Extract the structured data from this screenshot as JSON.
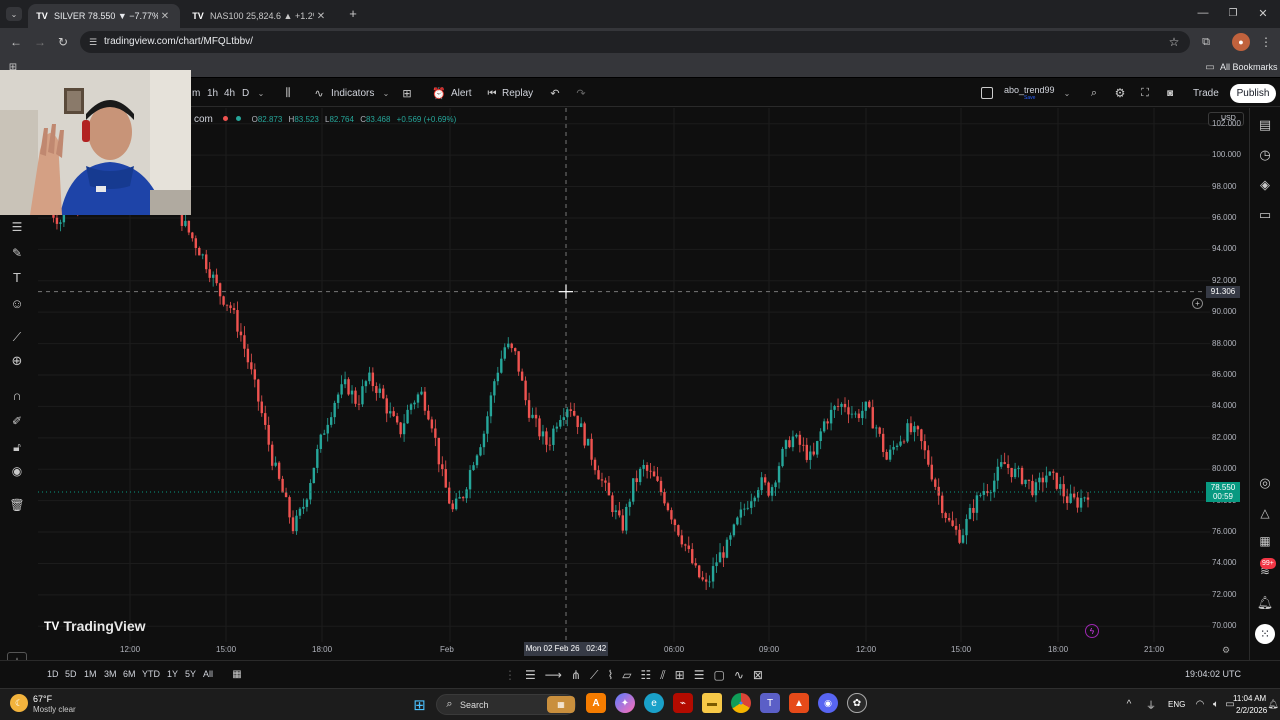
{
  "browser": {
    "tabs": [
      {
        "favicon": "tradingview-icon",
        "title": "SILVER 78.550 ▼ −7.77% abo_t...",
        "active": true
      },
      {
        "favicon": "tradingview-icon",
        "title": "NAS100 25,824.6 ▲ +1.2% abo...",
        "active": false
      }
    ],
    "url": "tradingview.com/chart/MFQLtbbv/",
    "all_bookmarks": "All Bookmarks"
  },
  "toolbar": {
    "intervals": [
      "m",
      "1h",
      "4h",
      "D"
    ],
    "indicators": "Indicators",
    "alert": "Alert",
    "replay": "Replay",
    "layout_name": "abo_trend99",
    "layout_status": "Save",
    "trade": "Trade",
    "publish": "Publish"
  },
  "legend": {
    "symbol": "com",
    "o_label": "O",
    "o": "82.873",
    "h_label": "H",
    "h": "83.523",
    "l_label": "L",
    "l": "82.764",
    "c_label": "C",
    "c": "83.468",
    "change": "+0.569 (+0.69%)"
  },
  "price_axis": {
    "currency": "USD",
    "ticks": [
      "102.000",
      "100.000",
      "98.000",
      "96.000",
      "94.000",
      "92.000",
      "90.000",
      "88.000",
      "86.000",
      "84.000",
      "82.000",
      "80.000",
      "78.000",
      "76.000",
      "74.000",
      "72.000",
      "70.000"
    ],
    "crosshair_price": "91.306",
    "last_price": "78.550",
    "countdown": "00:59"
  },
  "time_axis": {
    "ticks": [
      "12:00",
      "15:00",
      "18:00",
      "Feb",
      "06:00",
      "09:00",
      "12:00",
      "15:00",
      "18:00",
      "21:00"
    ],
    "crosshair_time": "Mon 02 Feb 26   02:42"
  },
  "watermark": "TradingView",
  "bottom": {
    "ranges": [
      "1D",
      "5D",
      "1M",
      "3M",
      "6M",
      "YTD",
      "1Y",
      "5Y",
      "All"
    ],
    "clock": "19:04:02 UTC"
  },
  "taskbar": {
    "weather_temp": "67°F",
    "weather_desc": "Mostly clear",
    "search": "Search",
    "lang": "ENG",
    "time": "11:04 AM",
    "date": "2/2/2026"
  },
  "notification_badge": "99+",
  "colors": {
    "up": "#26a69a",
    "down": "#ef5350",
    "last_price_bg": "#089981",
    "bg": "#0f0f0f"
  },
  "chart_data": {
    "type": "candlestick",
    "y_range": [
      69,
      103
    ],
    "series_y": [
      96.5,
      95.8,
      97.5,
      96.8,
      98.8,
      100.6,
      101.4,
      99.2,
      98.4,
      100.1,
      99.1,
      97.8,
      96.5,
      95.2,
      94.1,
      92.8,
      91.2,
      90.4,
      88.6,
      86.1,
      83.5,
      80.6,
      78.4,
      76.2,
      77.8,
      80.5,
      82.8,
      84.6,
      85.4,
      84.2,
      85.8,
      85.1,
      83.6,
      82.3,
      84.1,
      84.9,
      83.2,
      79.6,
      77.3,
      78.4,
      80.7,
      82.4,
      85.8,
      87.9,
      87.2,
      84.1,
      82.6,
      81.5,
      83.4,
      84.2,
      82.8,
      81.1,
      79.4,
      77.8,
      76.2,
      78.9,
      80.1,
      79.4,
      78.2,
      76.6,
      75.1,
      73.4,
      72.5,
      74.3,
      75.1,
      76.8,
      78.1,
      79.2,
      78.6,
      80.7,
      82.1,
      81.4,
      80.5,
      82.9,
      83.8,
      84.2,
      83.4,
      83.9,
      82.7,
      80.6,
      81.8,
      82.5,
      82.1,
      80.3,
      78.1,
      76.4,
      75.7,
      77.4,
      78.6,
      79.1,
      80.4,
      79.8,
      79.4,
      78.6,
      79.7,
      79.2,
      78.1,
      77.9,
      78.55
    ]
  }
}
